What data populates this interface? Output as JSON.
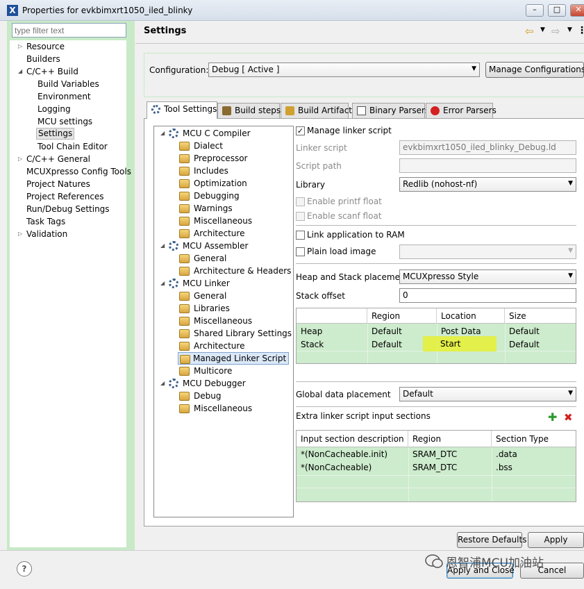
{
  "window": {
    "title": "Properties for evkbimxrt1050_iled_blinky",
    "app_icon": "X"
  },
  "left": {
    "filter_placeholder": "type filter text",
    "items": [
      {
        "label": "Resource",
        "expander": "▷"
      },
      {
        "label": "Builders",
        "expander": ""
      },
      {
        "label": "C/C++ Build",
        "expander": "◢"
      },
      {
        "label": "Build Variables",
        "expander": ""
      },
      {
        "label": "Environment",
        "expander": ""
      },
      {
        "label": "Logging",
        "expander": ""
      },
      {
        "label": "MCU settings",
        "expander": ""
      },
      {
        "label": "Settings",
        "expander": ""
      },
      {
        "label": "Tool Chain Editor",
        "expander": ""
      },
      {
        "label": "C/C++ General",
        "expander": "▷"
      },
      {
        "label": "MCUXpresso Config Tools",
        "expander": ""
      },
      {
        "label": "Project Natures",
        "expander": ""
      },
      {
        "label": "Project References",
        "expander": ""
      },
      {
        "label": "Run/Debug Settings",
        "expander": ""
      },
      {
        "label": "Task Tags",
        "expander": ""
      },
      {
        "label": "Validation",
        "expander": "▷"
      }
    ]
  },
  "header": {
    "title": "Settings"
  },
  "config": {
    "label": "Configuration:",
    "value": "Debug  [ Active ]",
    "manage_label": "Manage Configurations..."
  },
  "tabs": [
    {
      "label": "Tool Settings",
      "icon": "gear-icon"
    },
    {
      "label": "Build steps",
      "icon": "hammer-icon"
    },
    {
      "label": "Build Artifact",
      "icon": "artifact-icon"
    },
    {
      "label": "Binary Parsers",
      "icon": "binary-icon"
    },
    {
      "label": "Error Parsers",
      "icon": "error-icon"
    }
  ],
  "tool_tree": [
    {
      "label": "MCU C Compiler",
      "type": "group",
      "expander": "◢"
    },
    {
      "label": "Dialect",
      "type": "leaf"
    },
    {
      "label": "Preprocessor",
      "type": "leaf"
    },
    {
      "label": "Includes",
      "type": "leaf"
    },
    {
      "label": "Optimization",
      "type": "leaf"
    },
    {
      "label": "Debugging",
      "type": "leaf"
    },
    {
      "label": "Warnings",
      "type": "leaf"
    },
    {
      "label": "Miscellaneous",
      "type": "leaf"
    },
    {
      "label": "Architecture",
      "type": "leaf"
    },
    {
      "label": "MCU Assembler",
      "type": "group",
      "expander": "◢"
    },
    {
      "label": "General",
      "type": "leaf"
    },
    {
      "label": "Architecture & Headers",
      "type": "leaf"
    },
    {
      "label": "MCU Linker",
      "type": "group",
      "expander": "◢"
    },
    {
      "label": "General",
      "type": "leaf"
    },
    {
      "label": "Libraries",
      "type": "leaf"
    },
    {
      "label": "Miscellaneous",
      "type": "leaf"
    },
    {
      "label": "Shared Library Settings",
      "type": "leaf"
    },
    {
      "label": "Architecture",
      "type": "leaf"
    },
    {
      "label": "Managed Linker Script",
      "type": "leaf"
    },
    {
      "label": "Multicore",
      "type": "leaf"
    },
    {
      "label": "MCU Debugger",
      "type": "group",
      "expander": "◢"
    },
    {
      "label": "Debug",
      "type": "leaf"
    },
    {
      "label": "Miscellaneous",
      "type": "leaf"
    }
  ],
  "form": {
    "manage_linker_script": "Manage linker script",
    "manage_linker_script_check": "✓",
    "linker_script_label": "Linker script",
    "linker_script_value": "evkbimxrt1050_iled_blinky_Debug.ld",
    "script_path_label": "Script path",
    "library_label": "Library",
    "library_value": "Redlib (nohost-nf)",
    "enable_printf_float": "Enable printf float",
    "enable_scanf_float": "Enable scanf float",
    "link_to_ram": "Link application to RAM",
    "plain_load_image": "Plain load image",
    "heap_stack_label": "Heap and Stack placement",
    "heap_stack_value": "MCUXpresso Style",
    "stack_offset_label": "Stack offset",
    "stack_offset_value": "0",
    "global_data_label": "Global data placement",
    "global_data_value": "Default",
    "extra_sections_label": "Extra linker script input sections"
  },
  "heap_table": {
    "headers": [
      "",
      "Region",
      "Location",
      "Size"
    ],
    "rows": [
      [
        "Heap",
        "Default",
        "Post Data",
        "Default"
      ],
      [
        "Stack",
        "Default",
        "Start",
        "Default"
      ]
    ]
  },
  "sections_table": {
    "headers": [
      "Input section description",
      "Region",
      "Section Type"
    ],
    "rows": [
      [
        "*(NonCacheable.init)",
        "SRAM_DTC",
        ".data"
      ],
      [
        "*(NonCacheable)",
        "SRAM_DTC",
        ".bss"
      ]
    ]
  },
  "buttons": {
    "restore_defaults": "Restore Defaults",
    "apply": "Apply",
    "apply_close": "Apply and Close",
    "cancel": "Cancel",
    "help": "?"
  },
  "watermark": "恩智浦MCU加油站"
}
